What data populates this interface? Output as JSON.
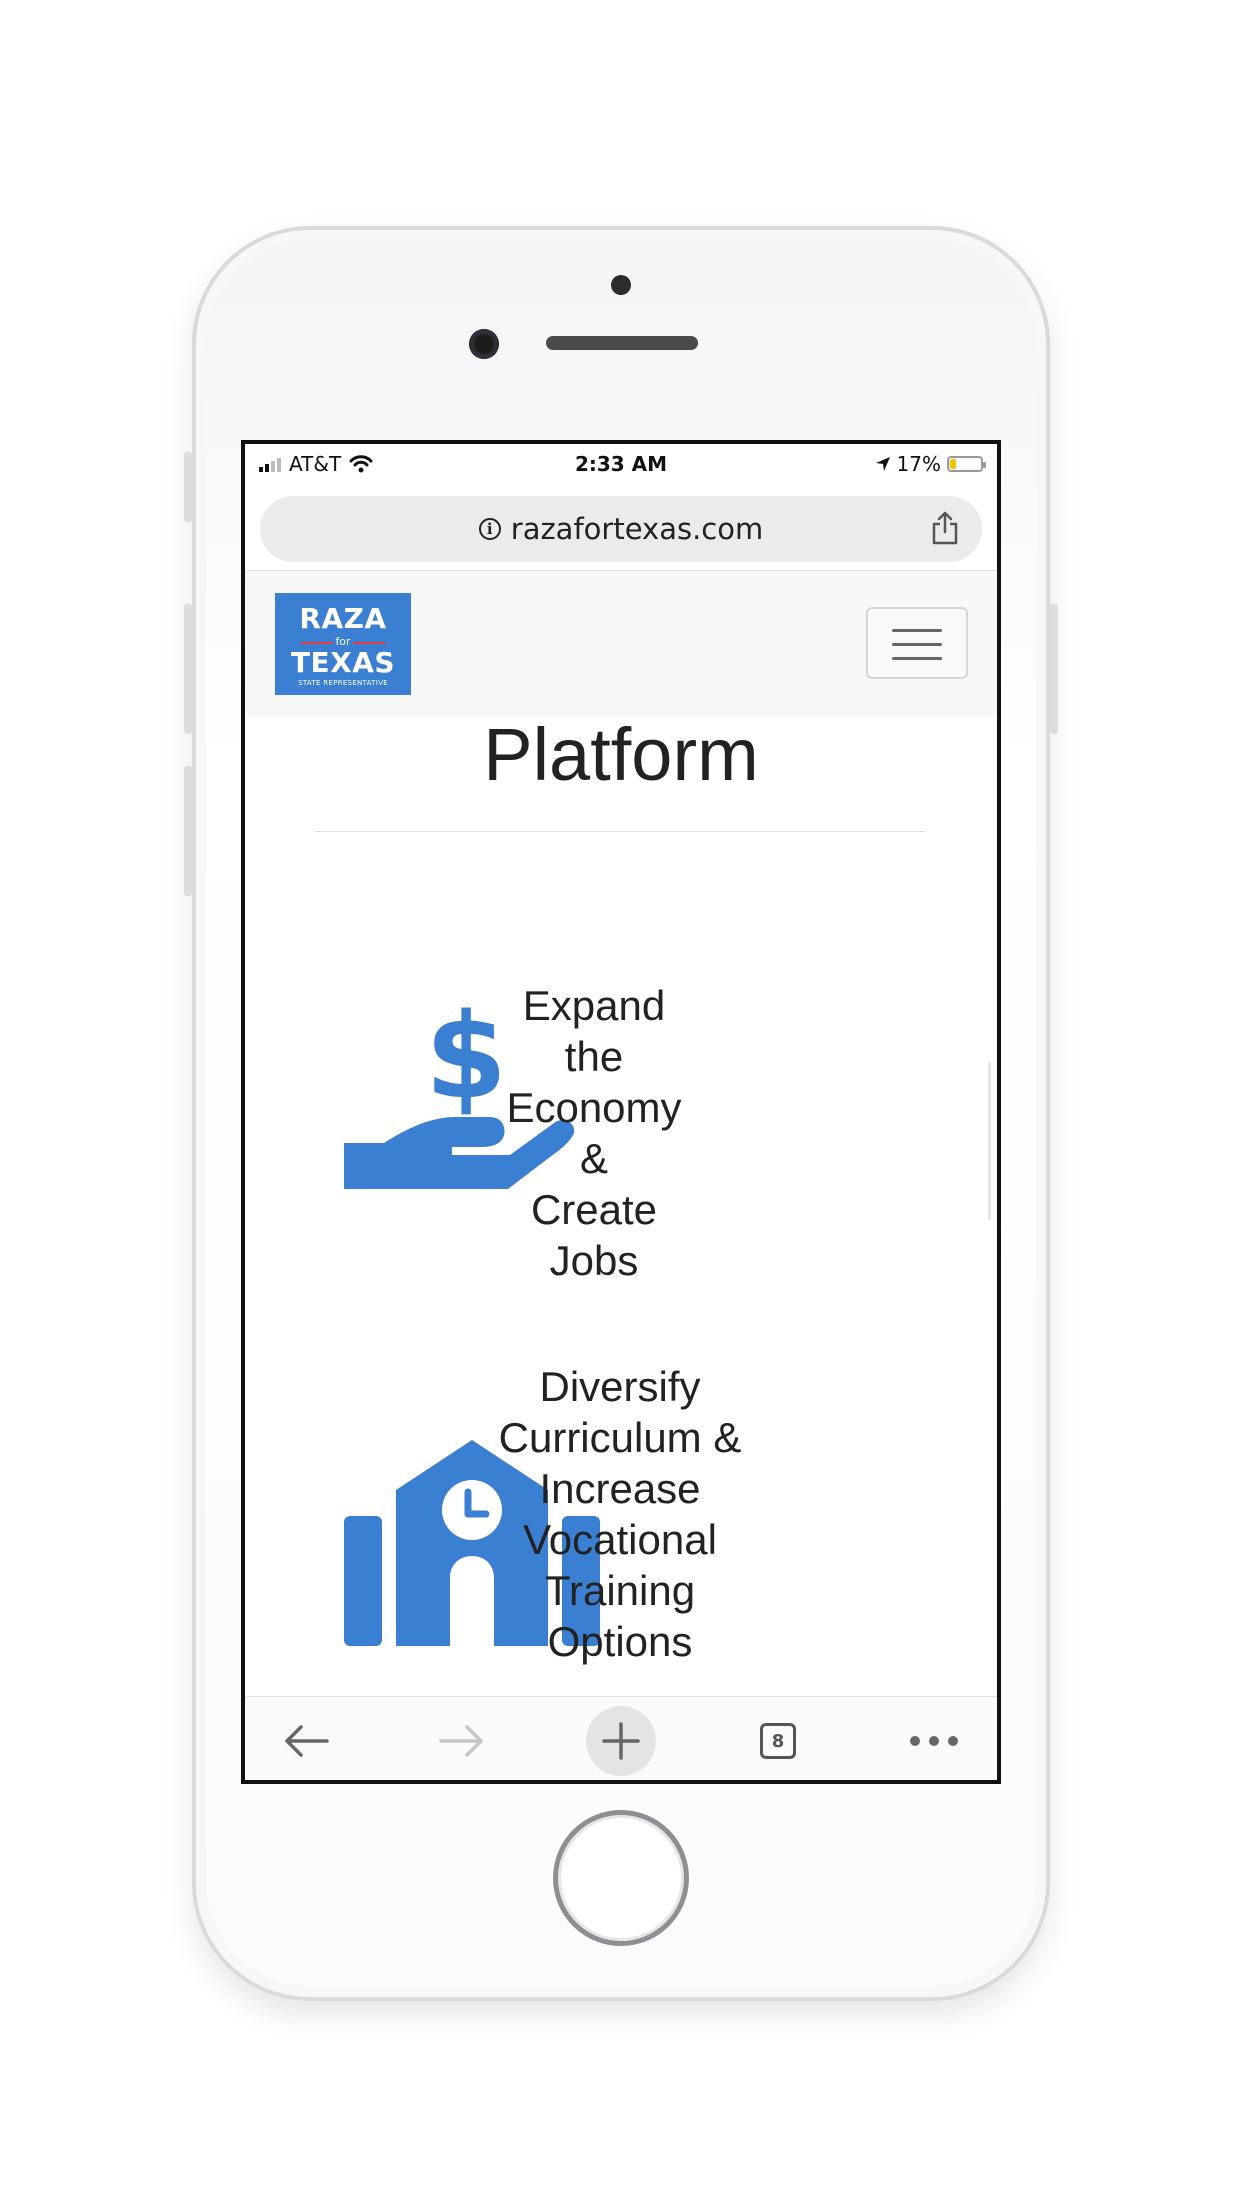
{
  "status_bar": {
    "carrier": "AT&T",
    "time": "2:33 AM",
    "battery_percent": "17%",
    "battery_level": 0.17
  },
  "browser": {
    "url": "razafortexas.com"
  },
  "site": {
    "logo": {
      "line1": "RAZA",
      "line2": "for",
      "line3": "TEXAS",
      "line4": "STATE REPRESENTATIVE"
    },
    "page_title": "Platform",
    "platform_items": [
      {
        "icon": "hand-dollar-icon",
        "lines": [
          "Expand the",
          "Economy &",
          "Create Jobs"
        ]
      },
      {
        "icon": "school-building-icon",
        "lines": [
          "Diversify",
          "Curriculum &",
          "Increase",
          "Vocational",
          "Training",
          "Options"
        ]
      }
    ]
  },
  "toolbar": {
    "tab_count": "8"
  },
  "colors": {
    "accent_blue": "#3a7fd2",
    "logo_red": "#e23a3a"
  }
}
